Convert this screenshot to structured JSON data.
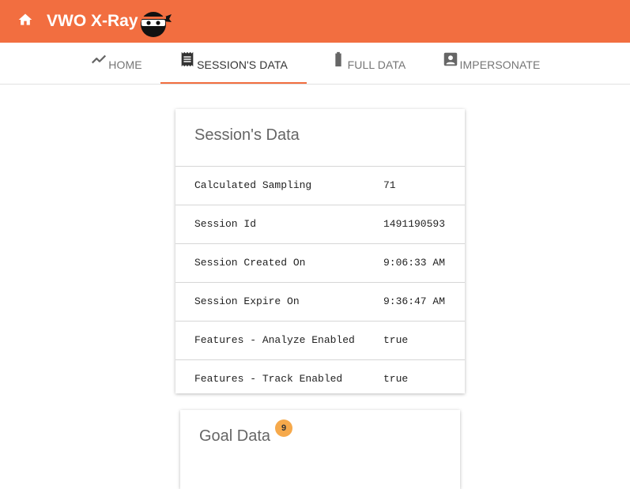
{
  "header": {
    "title": "VWO X-Ray",
    "brand_color": "#f26e40",
    "home_icon": "home-icon",
    "logo_icon": "ninja-logo"
  },
  "tabs": [
    {
      "label": "HOME",
      "icon": "trending-line-icon",
      "active": false
    },
    {
      "label": "SESSION'S DATA",
      "icon": "receipt-icon",
      "active": true
    },
    {
      "label": "FULL DATA",
      "icon": "battery-icon",
      "active": false
    },
    {
      "label": "IMPERSONATE",
      "icon": "account-box-icon",
      "active": false
    }
  ],
  "session_card": {
    "title": "Session's Data",
    "rows": [
      {
        "key": "Calculated Sampling",
        "value": "71"
      },
      {
        "key": "Session Id",
        "value": "1491190593"
      },
      {
        "key": "Session Created On",
        "value": "9:06:33 AM"
      },
      {
        "key": "Session Expire On",
        "value": "9:36:47 AM"
      },
      {
        "key": "Features - Analyze Enabled",
        "value": "true"
      },
      {
        "key": "Features - Track Enabled",
        "value": "true"
      }
    ]
  },
  "goal_card": {
    "title": "Goal Data",
    "badge_count": "9",
    "badge_color": "#f6a94b"
  }
}
